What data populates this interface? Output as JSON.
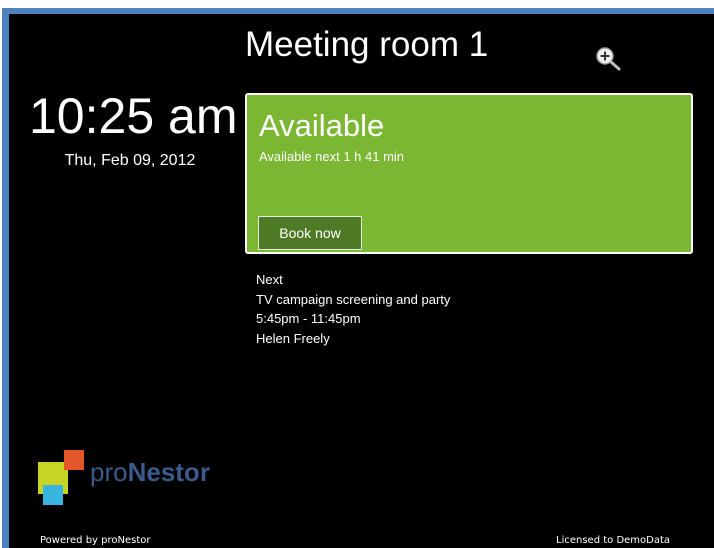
{
  "room": {
    "title": "Meeting room 1"
  },
  "clock": {
    "time": "10:25 am",
    "date": "Thu, Feb 09, 2012"
  },
  "status": {
    "title": "Available",
    "subtitle": "Available next 1 h 41 min",
    "book_label": "Book now",
    "color": "#7cb734"
  },
  "next_meeting": {
    "heading": "Next",
    "name": "TV campaign screening and party",
    "time": "5:45pm - 11:45pm",
    "organizer": "Helen Freely"
  },
  "brand": {
    "name_light": "pro",
    "name_bold": "Nestor"
  },
  "footer": {
    "powered_by": "Powered by proNestor",
    "license": "Licensed to DemoData"
  },
  "icons": {
    "zoom": "zoom-in-icon"
  },
  "colors": {
    "frame": "#4f81bd",
    "background": "#000000",
    "button": "#4e7a26"
  }
}
